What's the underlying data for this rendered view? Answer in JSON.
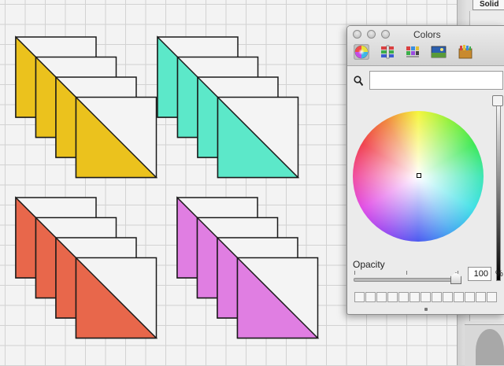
{
  "canvas": {
    "block_groups": [
      {
        "color_name": "yellow",
        "fill": "#ebc21d",
        "copies": 4
      },
      {
        "color_name": "turquoise",
        "fill": "#5ce8c9",
        "copies": 4
      },
      {
        "color_name": "coral",
        "fill": "#e8674b",
        "copies": 4
      },
      {
        "color_name": "orchid",
        "fill": "#e07ee2",
        "copies": 4
      }
    ],
    "grid_color": "#d2d2d2",
    "background": "#f3f3f3"
  },
  "right_strip": {
    "tab_label": "Solid"
  },
  "colors_window": {
    "title": "Colors",
    "traffic_lights": [
      "close-button",
      "minimize-button",
      "zoom-button"
    ],
    "tools": [
      {
        "name": "color-wheel-tool-icon",
        "selected": true
      },
      {
        "name": "color-sliders-tool-icon",
        "selected": false
      },
      {
        "name": "color-palettes-tool-icon",
        "selected": false
      },
      {
        "name": "image-palettes-tool-icon",
        "selected": false
      },
      {
        "name": "crayons-tool-icon",
        "selected": false
      }
    ],
    "search": {
      "value": "",
      "icon": "search-icon"
    },
    "opacity": {
      "label": "Opacity",
      "value": "100",
      "unit": "%"
    },
    "swatch_count": 13
  }
}
